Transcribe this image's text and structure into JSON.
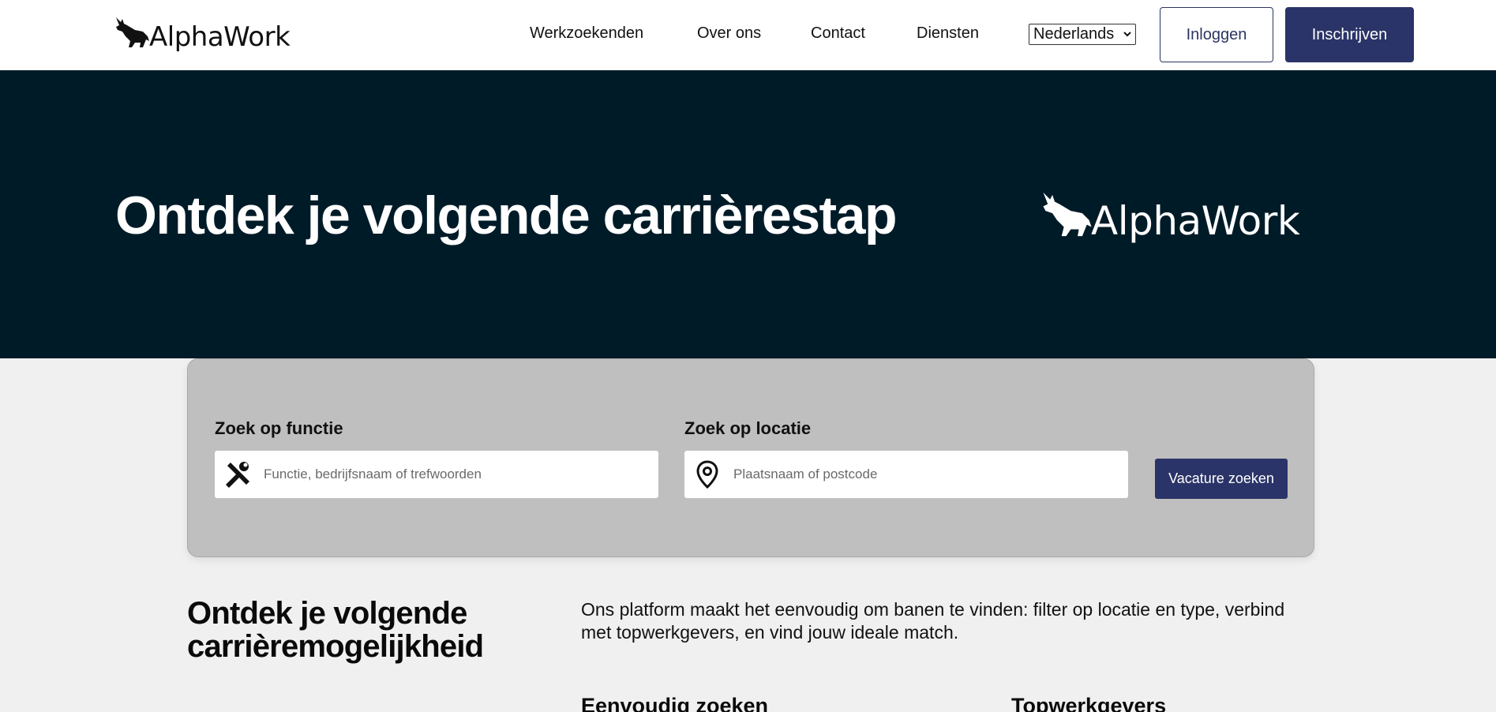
{
  "brand": {
    "name": "AlphaWork"
  },
  "nav": {
    "items": [
      "Werkzoekenden",
      "Over ons",
      "Contact",
      "Diensten"
    ],
    "language": "Nederlands",
    "login_label": "Inloggen",
    "signup_label": "Inschrijven"
  },
  "hero": {
    "title": "Ontdek je volgende carrièrestap"
  },
  "search": {
    "function_label": "Zoek op functie",
    "function_placeholder": "Functie, bedrijfsnaam of trefwoorden",
    "location_label": "Zoek op locatie",
    "location_placeholder": "Plaatsnaam of postcode",
    "button_label": "Vacature zoeken"
  },
  "intro": {
    "title": "Ontdek je volgende carrièremogelijkheid",
    "text": "Ons platform maakt het eenvoudig om banen te vinden: filter op locatie en type, verbind met topwerkgevers, en vind jouw ideale match.",
    "features": [
      "Eenvoudig zoeken",
      "Topwerkgevers"
    ]
  },
  "colors": {
    "navy": "#2b3468",
    "hero_bg": "#001b28",
    "card_bg": "#bfbfbf",
    "page_bg": "#f0f0f0"
  },
  "icons": {
    "function": "tools-icon",
    "location": "map-pin-icon",
    "logo": "wolf-icon"
  }
}
